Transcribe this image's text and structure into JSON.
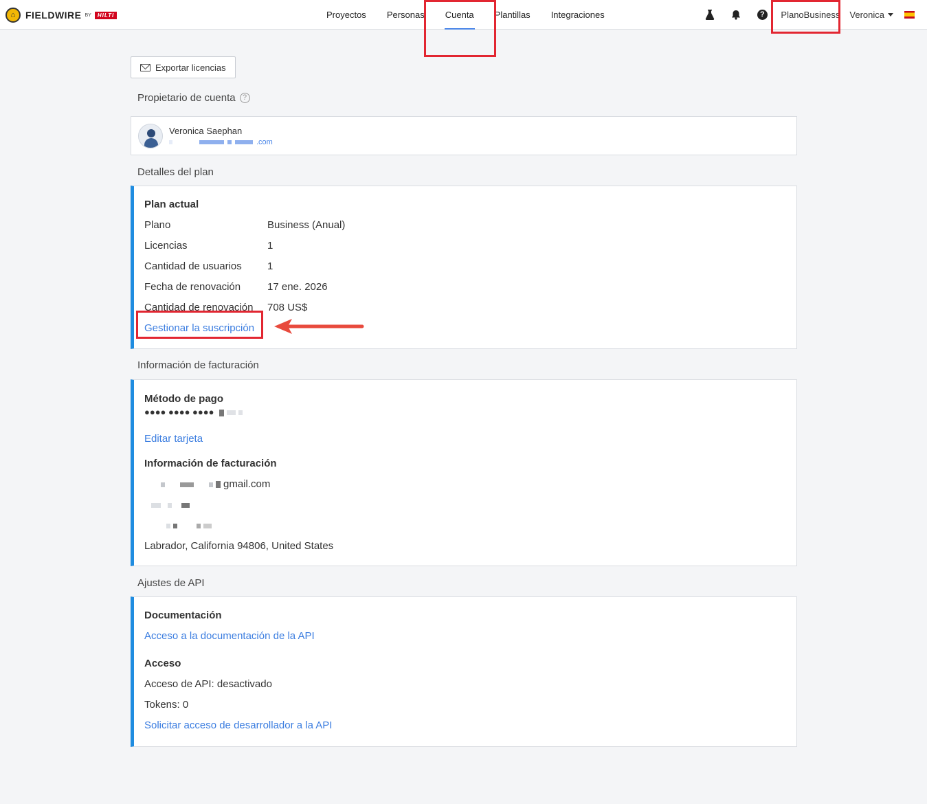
{
  "brand": {
    "logo_text": "FIELDWIRE",
    "by": "BY",
    "partner": "HILTI"
  },
  "nav": {
    "tabs": [
      {
        "label": "Proyectos"
      },
      {
        "label": "Personas"
      },
      {
        "label": "Cuenta"
      },
      {
        "label": "Plantillas"
      },
      {
        "label": "Integraciones"
      }
    ],
    "active_tab": "Cuenta",
    "plan_name": "PlanoBusiness",
    "user_name": "Veronica",
    "help_glyph": "?"
  },
  "icons": {
    "lab": "flask-icon",
    "notifications": "bell-icon",
    "help": "help-icon",
    "language": "spain-flag-icon",
    "export": "mail-icon"
  },
  "colors": {
    "accent": "#1f8ce0",
    "link": "#3b7de0",
    "highlight": "#e22631",
    "arrow": "#e84a3d"
  },
  "export_button": {
    "label": "Exportar licencias"
  },
  "owner": {
    "section_title": "Propietario de cuenta",
    "name": "Veronica Saephan",
    "email_visible_suffix": ".com"
  },
  "plan": {
    "section_title": "Detalles del plan",
    "heading": "Plan actual",
    "rows": [
      {
        "key": "Plano",
        "value": "Business (Anual)"
      },
      {
        "key": "Licencias",
        "value": "1"
      },
      {
        "key": "Cantidad de usuarios",
        "value": "1"
      },
      {
        "key": "Fecha de renovación",
        "value": "17 ene. 2026"
      },
      {
        "key": "Cantidad de renovación",
        "value": "708 US$"
      }
    ],
    "manage_link": "Gestionar la suscripción"
  },
  "billing": {
    "section_title": "Información de facturación",
    "payment_heading": "Método de pago",
    "card_mask": "●●●● ●●●● ●●●●",
    "edit_card": "Editar tarjeta",
    "info_heading": "Información de facturación",
    "email_visible_suffix": "gmail.com",
    "address_line": "Labrador, California 94806, United States"
  },
  "api": {
    "section_title": "Ajustes de API",
    "doc_heading": "Documentación",
    "doc_link": "Acceso a la documentación de la API",
    "access_heading": "Acceso",
    "access_status": "Acceso de API: desactivado",
    "tokens": "Tokens: 0",
    "request_link": "Solicitar acceso de desarrollador a la API"
  }
}
